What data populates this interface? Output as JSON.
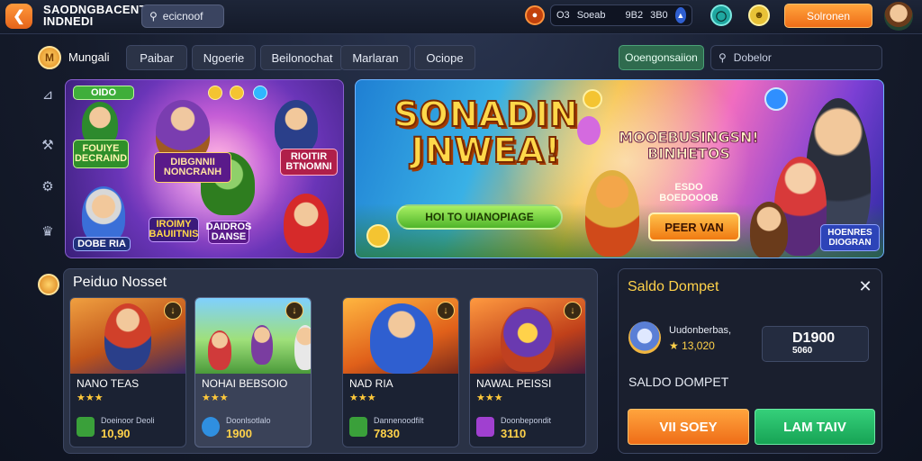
{
  "header": {
    "app_title": "SAODNGBACENT INDNEDI",
    "search_text": "ecicnoof",
    "stats": [
      "O3",
      "Soeab",
      "9B2",
      "3B0"
    ],
    "cta_label": "Solronen"
  },
  "icons": {
    "back": "arrow-left-icon",
    "search": "search-icon",
    "notification": "record-icon",
    "shield": "shield-icon",
    "globe": "globe-icon",
    "coin": "coin-icon",
    "close": "close-icon"
  },
  "nav": {
    "brand": "Mungali",
    "tabs": [
      "Paibar",
      "Ngoerie",
      "Beilonochat",
      "Marlaran",
      "Ociope"
    ],
    "category_button": "Ooengonsaiion",
    "search_placeholder": "Dobelor"
  },
  "banners": {
    "left": {
      "tag_top": "OIDO",
      "sticker_a": "FOUIYE DECRAIND",
      "sticker_b": "DIBGNNII NONCRANH",
      "sticker_c": "RIOITIR BTNOMNI",
      "sticker_d": "DOBE RIA",
      "sticker_e": "IROIMY BAUIITNIS",
      "sticker_f": "DAIDROS DANSE"
    },
    "right": {
      "title": "SONADIN JNWEA!",
      "subtitle": "MOOEBUSINGSN! BINHETOS",
      "tagline": "ESDO BOEDOOOB",
      "pill": "HOI TO UIANOPIAGE",
      "cta": "PEER VAN",
      "corner_badge": "HOENRES DIOGRAN"
    }
  },
  "games": {
    "title": "Peiduo Nosset",
    "cards": [
      {
        "name": "NANO TEAS",
        "stars": "★★★",
        "meta": "Doeinoor Deoli",
        "price": "10,90"
      },
      {
        "name": "NOHAI BEBSOIO",
        "stars": "★★★",
        "meta": "Doonlsotlalo",
        "price": "1900"
      },
      {
        "name": "NAD RIA",
        "stars": "★★★",
        "meta": "Dannenoodfilt",
        "price": "7830"
      },
      {
        "name": "NAWAL PEISSI",
        "stars": "★★★",
        "meta": "Doonbepondit",
        "price": "3110"
      }
    ]
  },
  "wallet": {
    "title": "Saldo Dompet",
    "user": "Uudonberbas,",
    "points": "★ 13,020",
    "balance_big": "D1900",
    "balance_small": "5060",
    "label": "SALDO DOMPET",
    "btn_primary": "VII SOEY",
    "btn_secondary": "LAM TAIV"
  },
  "colors": {
    "accent_orange": "#ef6d18",
    "accent_green": "#17a355",
    "gold": "#ffd24a",
    "panel": "#2a3246"
  }
}
